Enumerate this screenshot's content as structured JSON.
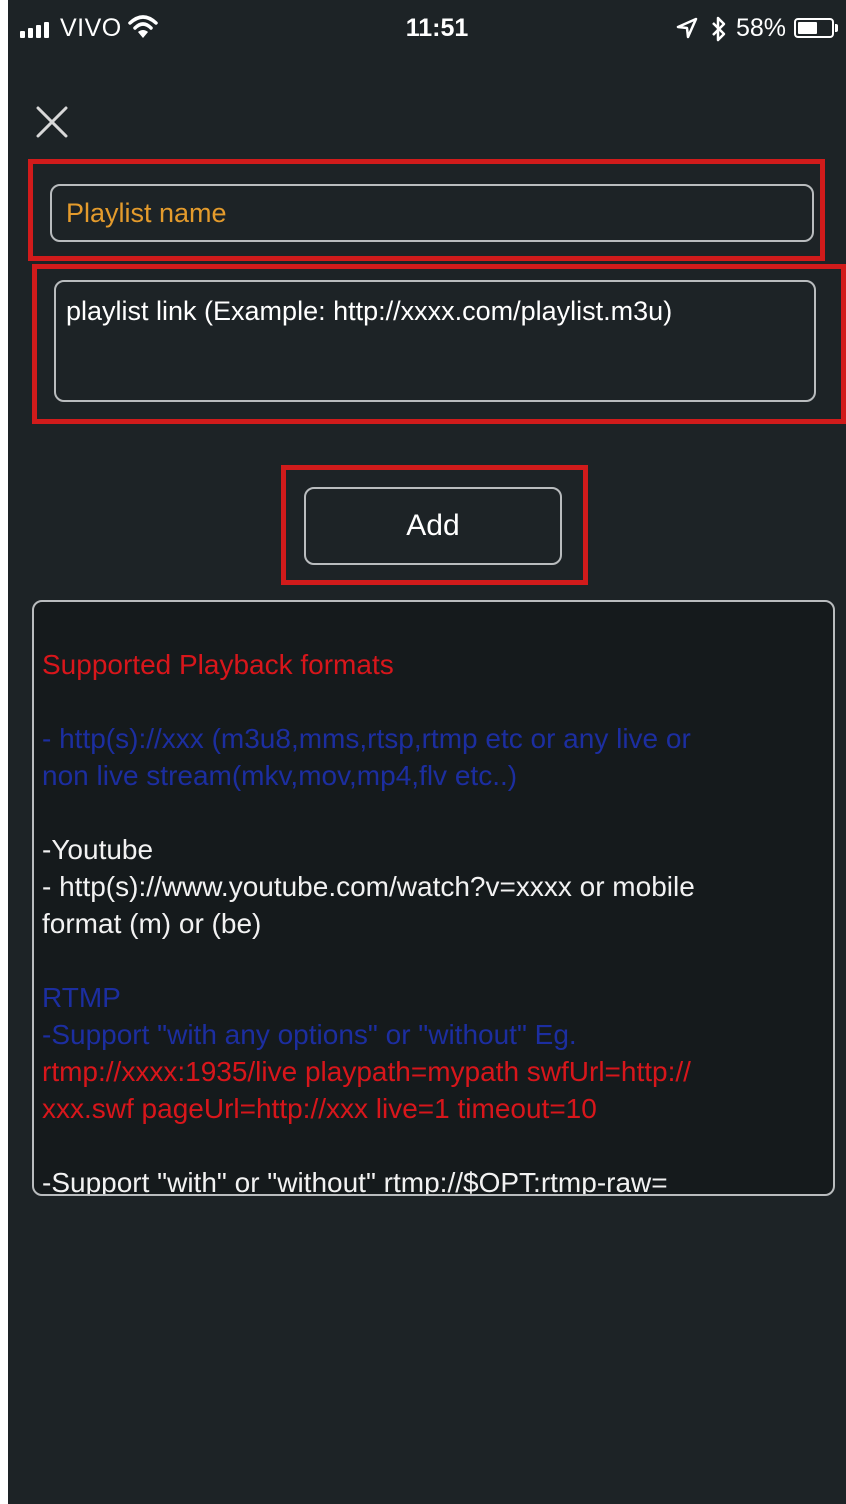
{
  "status_bar": {
    "carrier": "VIVO",
    "time": "11:51",
    "battery": "58%",
    "battery_level": 0.58
  },
  "form": {
    "name_placeholder": "Playlist name",
    "link_placeholder": "playlist link (Example: http://xxxx.com/playlist.m3u)",
    "add_label": "Add"
  },
  "info": {
    "heading": "Supported Playback formats",
    "http_line1": "- http(s)://xxx (m3u8,mms,rtsp,rtmp etc or any live or",
    "http_line2": "non live stream(mkv,mov,mp4,flv etc..)",
    "youtube_title": "-Youtube",
    "youtube_line1": "- http(s)://www.youtube.com/watch?v=xxxx or mobile",
    "youtube_line2": "format (m) or (be)",
    "rtmp_title": "RTMP",
    "rtmp_support": "-Support \"with any options\" or \"without\" Eg.",
    "rtmp_example1": "rtmp://xxxx:1935/live playpath=mypath swfUrl=http://",
    "rtmp_example2": "xxx.swf pageUrl=http://xxx live=1 timeout=10",
    "rtmp_raw": "-Support \"with\" or \"without\" rtmp://$OPT:rtmp-raw="
  },
  "colors": {
    "background": "#1d2326",
    "highlight": "#d11b1b",
    "placeholder_orange": "#e49b2c",
    "red_text": "#d8161b",
    "blue_text": "#1c2ea0"
  }
}
